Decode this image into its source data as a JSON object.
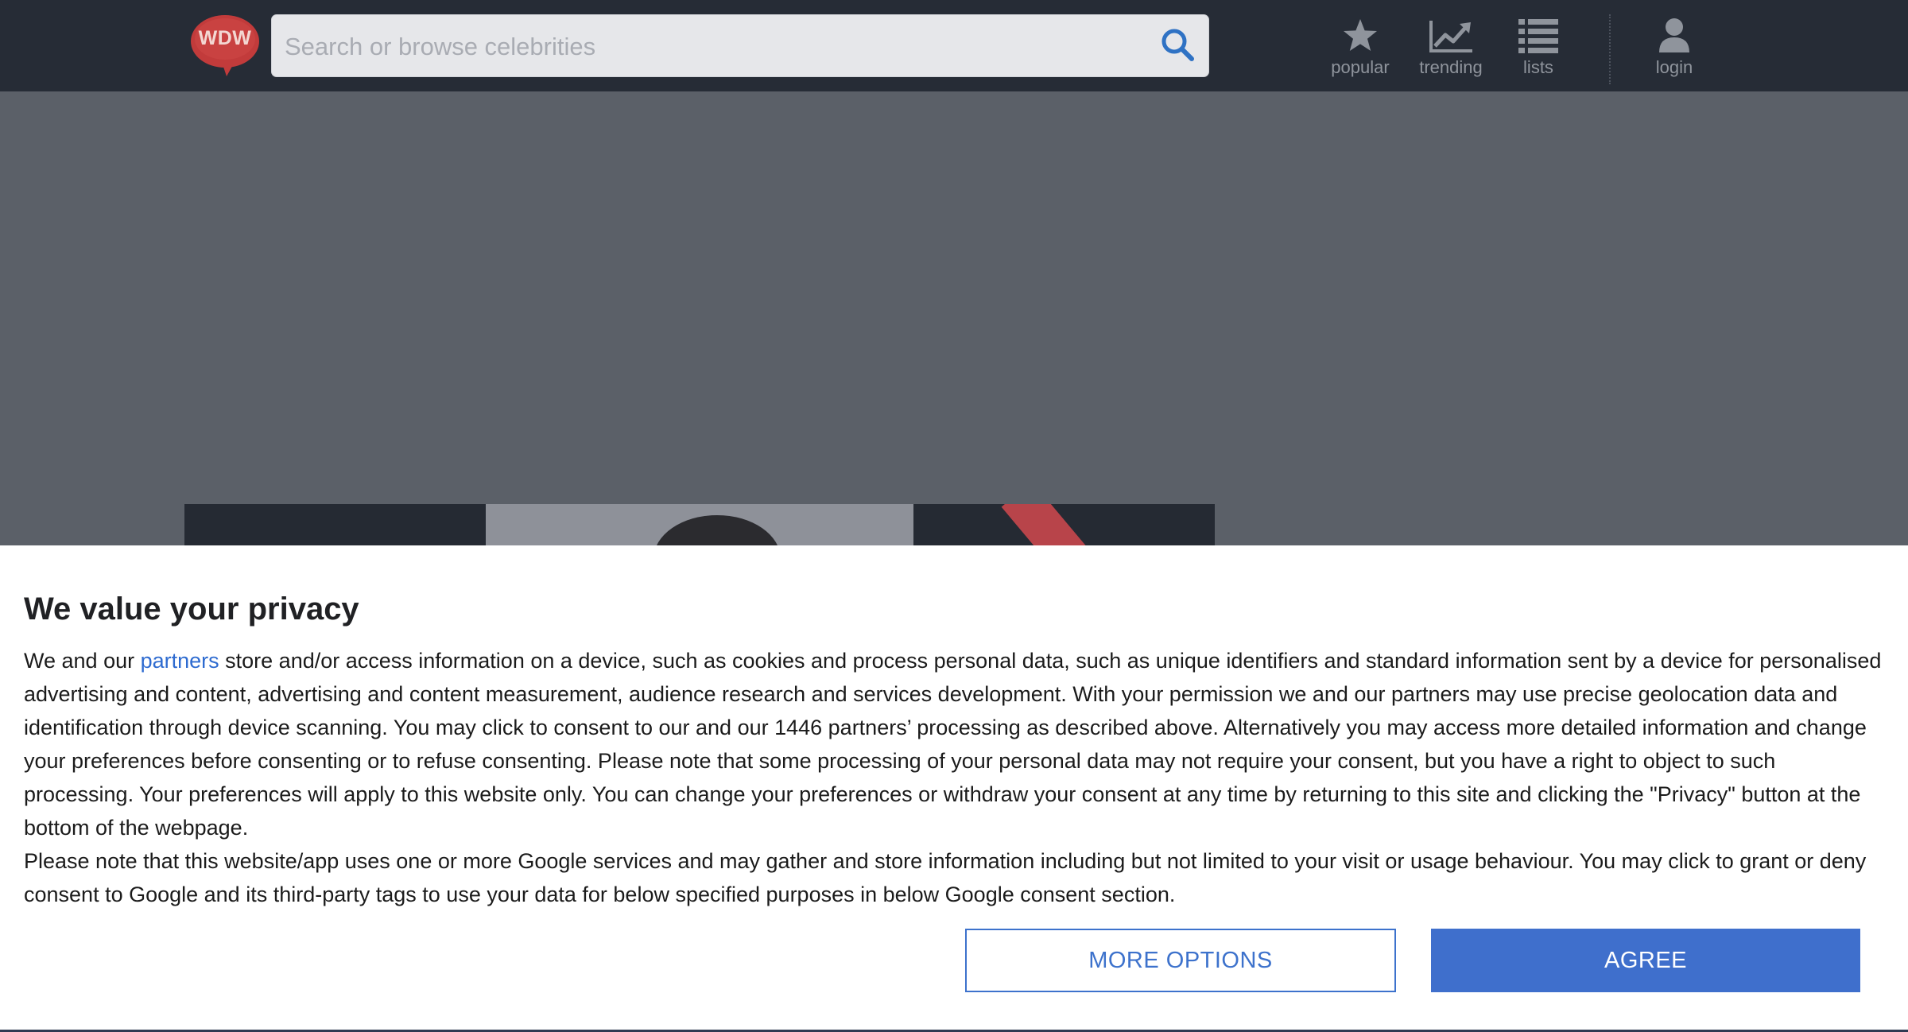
{
  "header": {
    "logo_text": "WDW",
    "search": {
      "placeholder": "Search or browse celebrities",
      "value": ""
    },
    "nav": {
      "popular": "popular",
      "trending": "trending",
      "lists": "lists",
      "login": "login"
    }
  },
  "consent": {
    "title": "We value your privacy",
    "p1_before_link": "We and our ",
    "p1_link": "partners",
    "p1_after_link": " store and/or access information on a device, such as cookies and process personal data, such as unique identifiers and standard information sent by a device for personalised advertising and content, advertising and content measurement, audience research and services development. With your permission we and our partners may use precise geolocation data and identification through device scanning. You may click to consent to our and our 1446 partners’ processing as described above. Alternatively you may access more detailed information and change your preferences before consenting or to refuse consenting. Please note that some processing of your personal data may not require your consent, but you have a right to object to such processing. Your preferences will apply to this website only. You can change your preferences or withdraw your consent at any time by returning to this site and clicking the \"Privacy\" button at the bottom of the webpage.",
    "p2": "Please note that this website/app uses one or more Google services and may gather and store information including but not limited to your visit or usage behaviour. You may click to grant or deny consent to Google and its third-party tags to use your data for below specified purposes in below Google consent section.",
    "more_options_label": "MORE OPTIONS",
    "agree_label": "AGREE"
  },
  "colors": {
    "topbar": "#262c36",
    "overlay": "#5b6068",
    "accent_blue": "#3f6fcc",
    "link_blue": "#2e6bd0",
    "logo_red": "#c23b3b"
  },
  "icons": {
    "logo": "wdw-speech-bubble-logo",
    "search": "search-icon",
    "popular": "star-icon",
    "trending": "trending-chart-icon",
    "lists": "list-icon",
    "login": "user-icon"
  }
}
